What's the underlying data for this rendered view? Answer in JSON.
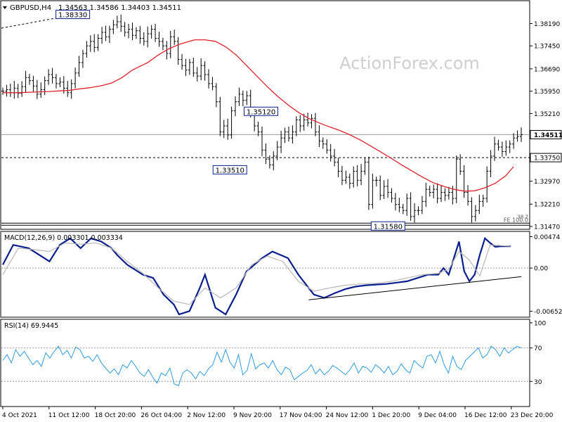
{
  "header": {
    "symbol": "GBPUSD,H4",
    "ohlc": "1.34563 1.34586 1.34403 1.34511"
  },
  "watermark": "ActionForex.com",
  "chart_data": [
    {
      "type": "candlestick",
      "panel": "price",
      "ylim": [
        1.3147,
        1.3855
      ],
      "y_ticks": [
        "1.38190",
        "1.37450",
        "1.36690",
        "1.35950",
        "1.35210",
        "1.34511",
        "1.33750",
        "1.32970",
        "1.32210",
        "1.31470"
      ],
      "last_price": 1.34511,
      "last_price_label": "1.34511",
      "levels": [
        {
          "value": 1.3375,
          "label": "1.33750",
          "style": "dashed"
        },
        {
          "value": 1.3158,
          "style": "solid"
        }
      ],
      "annotations": [
        {
          "text": "1.38330",
          "t": 0.135
        },
        {
          "text": "1.33510",
          "t": 0.438
        },
        {
          "text": "1.35120",
          "t": 0.498
        },
        {
          "text": "1.31580",
          "t": 0.743
        }
      ],
      "fib_label": "FE 100.0",
      "fib_small": "38.2",
      "close_series": [
        1.3595,
        1.36,
        1.359,
        1.3605,
        1.3588,
        1.361,
        1.364,
        1.363,
        1.3612,
        1.3585,
        1.36,
        1.363,
        1.365,
        1.364,
        1.362,
        1.3625,
        1.3605,
        1.359,
        1.362,
        1.3655,
        1.369,
        1.372,
        1.3745,
        1.376,
        1.374,
        1.377,
        1.379,
        1.3775,
        1.38,
        1.3815,
        1.3825,
        1.381,
        1.379,
        1.38,
        1.378,
        1.3795,
        1.377,
        1.376,
        1.3785,
        1.38,
        1.377,
        1.376,
        1.3745,
        1.372,
        1.3775,
        1.376,
        1.37,
        1.368,
        1.3665,
        1.369,
        1.3655,
        1.3645,
        1.368,
        1.365,
        1.362,
        1.361,
        1.356,
        1.346,
        1.348,
        1.345,
        1.353,
        1.356,
        1.3585,
        1.3565,
        1.358,
        1.352,
        1.348,
        1.346,
        1.34,
        1.337,
        1.3351,
        1.338,
        1.341,
        1.344,
        1.346,
        1.344,
        1.346,
        1.35,
        1.348,
        1.35,
        1.349,
        1.3505,
        1.346,
        1.343,
        1.342,
        1.34,
        1.338,
        1.336,
        1.333,
        1.33,
        1.331,
        1.329,
        1.333,
        1.33,
        1.333,
        1.336,
        1.322,
        1.33,
        1.33,
        1.325,
        1.328,
        1.326,
        1.324,
        1.322,
        1.321,
        1.32,
        1.324,
        1.318,
        1.32,
        1.32,
        1.323,
        1.327,
        1.326,
        1.327,
        1.324,
        1.326,
        1.325,
        1.326,
        1.324,
        1.337,
        1.333,
        1.326,
        1.323,
        1.318,
        1.32,
        1.323,
        1.324,
        1.333,
        1.338,
        1.342,
        1.341,
        1.3395,
        1.341,
        1.342,
        1.344,
        1.3445,
        1.3451
      ],
      "sma_series": [
        1.359,
        1.359,
        1.3592,
        1.3594,
        1.3596,
        1.3598,
        1.3603,
        1.3607,
        1.3613,
        1.3622,
        1.364,
        1.3665,
        1.369,
        1.3715,
        1.3735,
        1.375,
        1.376,
        1.3765,
        1.3765,
        1.376,
        1.3742,
        1.3715,
        1.368,
        1.3645,
        1.361,
        1.3578,
        1.355,
        1.3525,
        1.3505,
        1.349,
        1.3477,
        1.3465,
        1.345,
        1.3433,
        1.3413,
        1.3393,
        1.3372,
        1.335,
        1.333,
        1.331,
        1.3292,
        1.328,
        1.327,
        1.3264,
        1.3265,
        1.3275,
        1.329,
        1.3315,
        1.3345
      ],
      "sma_t": [
        0.0,
        0.03,
        0.06,
        0.09,
        0.11,
        0.13,
        0.15,
        0.17,
        0.19,
        0.21,
        0.23,
        0.25,
        0.28,
        0.3,
        0.32,
        0.34,
        0.36,
        0.37,
        0.39,
        0.41,
        0.43,
        0.45,
        0.47,
        0.49,
        0.51,
        0.53,
        0.55,
        0.57,
        0.59,
        0.61,
        0.63,
        0.65,
        0.67,
        0.69,
        0.71,
        0.73,
        0.75,
        0.77,
        0.79,
        0.81,
        0.83,
        0.85,
        0.87,
        0.89,
        0.91,
        0.93,
        0.95,
        0.97,
        0.985
      ]
    },
    {
      "type": "line",
      "panel": "macd",
      "label": "MACD(12,26,9) 0.003301 0.003334",
      "ylim": [
        -0.007,
        0.0049
      ],
      "y_ticks": [
        "0.00474",
        "0.00",
        "-0.006526"
      ],
      "zero_label": "0.00",
      "series": [
        {
          "name": "MACD",
          "t": [
            0.0,
            0.02,
            0.05,
            0.07,
            0.09,
            0.11,
            0.13,
            0.15,
            0.17,
            0.19,
            0.21,
            0.22,
            0.24,
            0.25,
            0.27,
            0.29,
            0.31,
            0.33,
            0.34,
            0.36,
            0.38,
            0.39,
            0.41,
            0.43,
            0.45,
            0.47,
            0.5,
            0.52,
            0.55,
            0.57,
            0.59,
            0.6,
            0.62,
            0.64,
            0.66,
            0.68,
            0.7,
            0.72,
            0.74,
            0.76,
            0.78,
            0.8,
            0.82,
            0.84,
            0.85,
            0.86,
            0.87,
            0.88,
            0.89,
            0.9,
            0.91,
            0.92,
            0.93,
            0.94,
            0.95,
            0.96,
            0.97,
            0.98
          ],
          "values": [
            0.0005,
            0.0035,
            0.003,
            0.002,
            0.001,
            0.0035,
            0.0045,
            0.003,
            0.0045,
            0.004,
            0.003,
            0.002,
            0.0005,
            0.0,
            -0.001,
            -0.0015,
            -0.004,
            -0.0055,
            -0.007,
            -0.0065,
            -0.003,
            -0.001,
            -0.006,
            -0.007,
            -0.004,
            -0.0005,
            0.0015,
            0.0025,
            0.0015,
            -0.001,
            -0.003,
            -0.004,
            -0.0045,
            -0.0038,
            -0.0032,
            -0.0028,
            -0.0026,
            -0.0025,
            -0.0024,
            -0.0022,
            -0.002,
            -0.0015,
            -0.001,
            -0.001,
            0.0,
            -0.001,
            0.0015,
            0.004,
            -0.0005,
            -0.002,
            -0.001,
            0.002,
            0.0045,
            0.0038,
            0.0032,
            0.0033,
            0.0033,
            0.0033
          ]
        },
        {
          "name": "Signal",
          "t": [
            0.0,
            0.03,
            0.06,
            0.09,
            0.12,
            0.15,
            0.18,
            0.21,
            0.24,
            0.27,
            0.3,
            0.33,
            0.36,
            0.39,
            0.42,
            0.45,
            0.48,
            0.51,
            0.54,
            0.57,
            0.6,
            0.63,
            0.66,
            0.69,
            0.72,
            0.75,
            0.78,
            0.81,
            0.84,
            0.86,
            0.88,
            0.9,
            0.92,
            0.94,
            0.96,
            0.98
          ],
          "values": [
            -0.001,
            0.003,
            0.0028,
            0.0025,
            0.0038,
            0.0036,
            0.0038,
            0.003,
            0.001,
            -0.0008,
            -0.003,
            -0.005,
            -0.0055,
            -0.003,
            -0.0045,
            -0.003,
            0.0005,
            0.0018,
            0.001,
            -0.002,
            -0.0035,
            -0.003,
            -0.0026,
            -0.0024,
            -0.0023,
            -0.002,
            -0.0015,
            -0.001,
            -0.0008,
            -0.0002,
            0.0025,
            0.0012,
            -0.0012,
            0.0035,
            0.0034,
            0.0033
          ]
        }
      ],
      "trendline": {
        "t1": 0.59,
        "v1": -0.0048,
        "t2": 1.0,
        "v2": -0.0013
      }
    },
    {
      "type": "line",
      "panel": "rsi",
      "label": "RSI(14) 69.9445",
      "ylim": [
        0,
        100
      ],
      "y_ticks": [
        "100",
        "70",
        "30",
        "0"
      ],
      "levels": [
        70,
        30
      ],
      "values": [
        55,
        62,
        52,
        68,
        60,
        66,
        58,
        50,
        55,
        48,
        64,
        58,
        66,
        72,
        62,
        67,
        58,
        71,
        68,
        58,
        60,
        54,
        62,
        52,
        46,
        40,
        45,
        38,
        50,
        46,
        55,
        48,
        40,
        36,
        44,
        35,
        28,
        40,
        37,
        46,
        27,
        25,
        40,
        44,
        40,
        33,
        42,
        37,
        45,
        50,
        65,
        53,
        68,
        53,
        46,
        62,
        38,
        43,
        63,
        45,
        50,
        52,
        46,
        55,
        44,
        38,
        47,
        44,
        32,
        36,
        40,
        43,
        50,
        39,
        45,
        38,
        42,
        49,
        46,
        42,
        38,
        44,
        52,
        40,
        48,
        46,
        41,
        50,
        46,
        40,
        48,
        38,
        42,
        51,
        44,
        40,
        55,
        50,
        46,
        60,
        62,
        52,
        66,
        50,
        40,
        60,
        48,
        44,
        55,
        60,
        65,
        70,
        58,
        62,
        72,
        68,
        60,
        70,
        64,
        68,
        72,
        70
      ]
    }
  ],
  "x_labels": [
    "4 Oct 2021",
    "11 Oct 12:00",
    "18 Oct 20:00",
    "26 Oct 04:00",
    "2 Nov 12:00",
    "9 Nov 20:00",
    "17 Nov 04:00",
    "24 Nov 12:00",
    "1 Dec 20:00",
    "9 Dec 04:00",
    "16 Dec 12:00",
    "23 Dec 20:00"
  ],
  "colors": {
    "candle": "#000000",
    "sma": "#e0222c",
    "macd": "#0a1f8f",
    "signal": "#b8b8b8",
    "rsi": "#2e9be6",
    "label_border": "#0a1f8f",
    "last_price_bg": "#ffffff"
  }
}
